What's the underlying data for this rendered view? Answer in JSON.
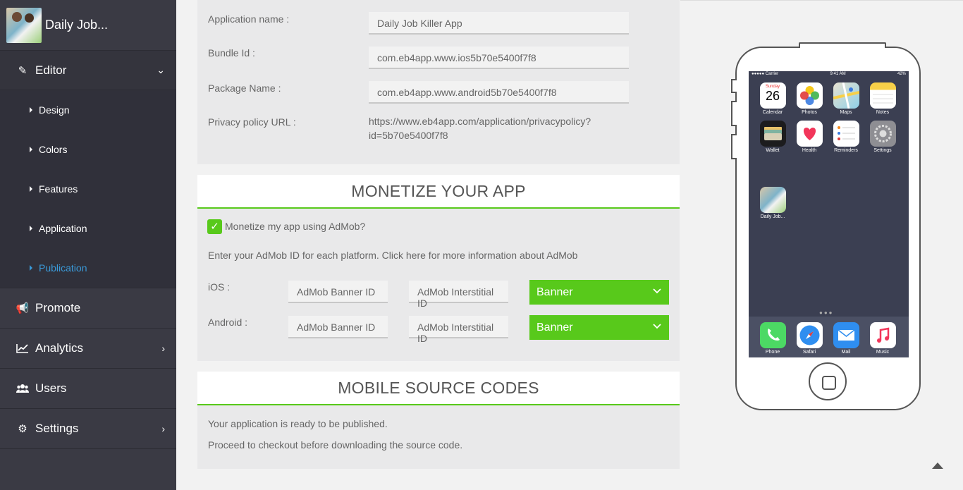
{
  "sidebar": {
    "app_title": "Daily Job...",
    "editor": "Editor",
    "sub_items": [
      "Design",
      "Colors",
      "Features",
      "Application",
      "Publication"
    ],
    "promote": "Promote",
    "analytics": "Analytics",
    "users": "Users",
    "settings": "Settings"
  },
  "application": {
    "app_name_label": "Application name :",
    "app_name_value": "Daily Job Killer App",
    "bundle_label": "Bundle Id :",
    "bundle_value": "com.eb4app.www.ios5b70e5400f7f8",
    "package_label": "Package Name :",
    "package_value": "com.eb4app.www.android5b70e5400f7f8",
    "privacy_label": "Privacy policy URL :",
    "privacy_value_line1": "https://www.eb4app.com/application/privacypolicy?",
    "privacy_value_line2": "id=5b70e5400f7f8"
  },
  "monetize": {
    "title": "MONETIZE YOUR APP",
    "checkbox_label": "Monetize my app using AdMob?",
    "info": "Enter your AdMob ID for each platform. Click here for more information about AdMob",
    "ios_label": "iOS :",
    "android_label": "Android :",
    "banner_placeholder": "AdMob Banner ID",
    "interstitial_placeholder": "AdMob Interstitial ID",
    "ios_select": "Banner",
    "android_select": "Banner"
  },
  "source": {
    "title": "MOBILE SOURCE CODES",
    "line1": "Your application is ready to be published.",
    "line2": "Proceed to checkout before downloading the source code."
  },
  "phone": {
    "carrier": "●●●●● Carrier",
    "time": "9:41 AM",
    "battery": "42%",
    "calendar_day": "Sunday",
    "calendar_date": "26",
    "apps": [
      "Calendar",
      "Photos",
      "Maps",
      "Notes",
      "Wallet",
      "Health",
      "Reminders",
      "Settings"
    ],
    "custom_app": "Daily Job...",
    "dock": [
      "Phone",
      "Safari",
      "Mail",
      "Music"
    ]
  },
  "colors": {
    "accent_green": "#58c91b",
    "sidebar_bg": "#3a3a44",
    "active_link": "#3a9ad9"
  }
}
